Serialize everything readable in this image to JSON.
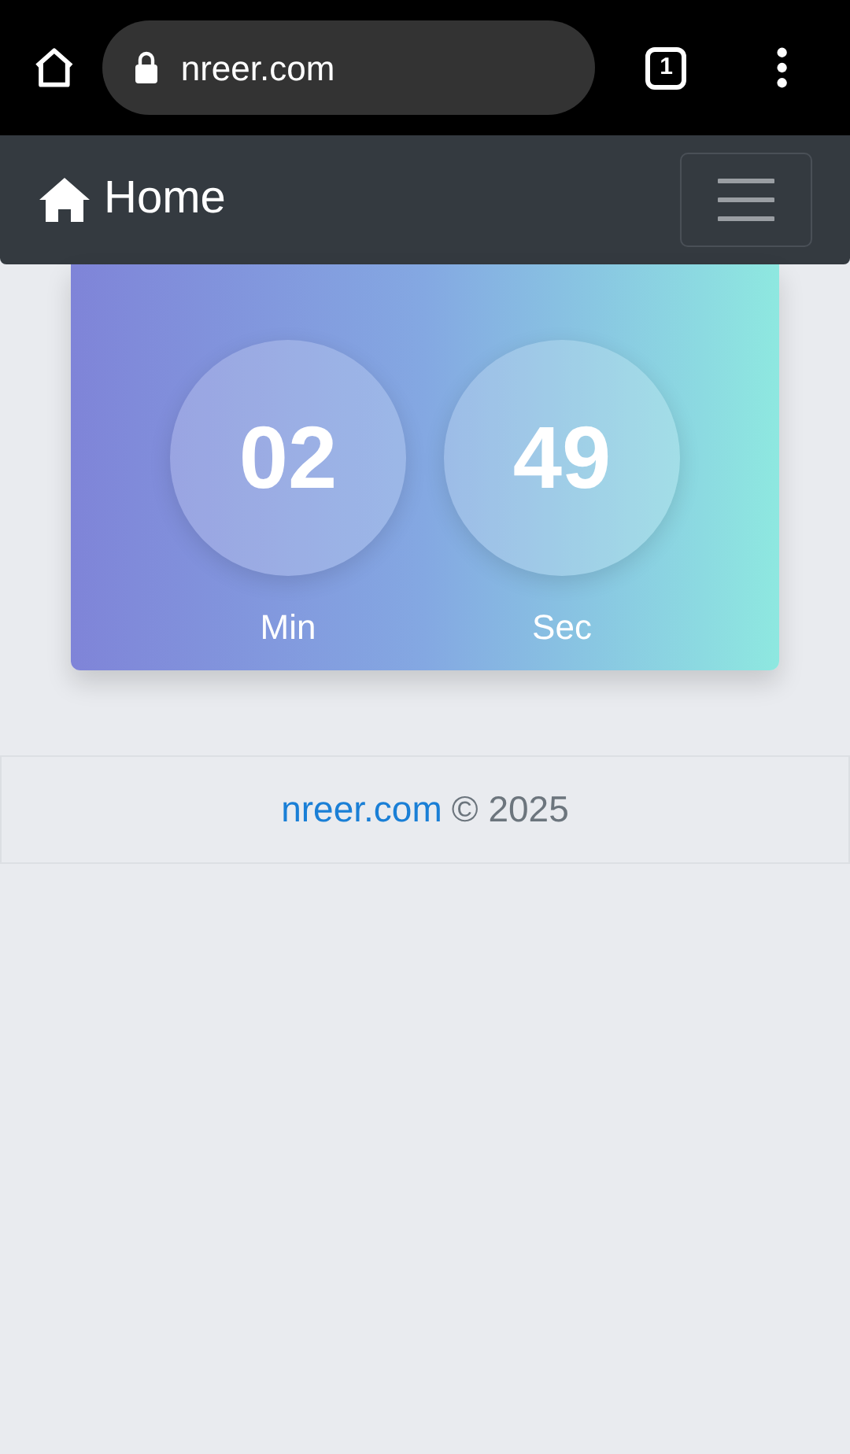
{
  "browser": {
    "url": "nreer.com",
    "tab_count": "1"
  },
  "navbar": {
    "brand": "Home"
  },
  "timer": [
    {
      "value": "02",
      "label": "Min"
    },
    {
      "value": "49",
      "label": "Sec"
    }
  ],
  "footer": {
    "link": "nreer.com",
    "text": "© 2025"
  }
}
